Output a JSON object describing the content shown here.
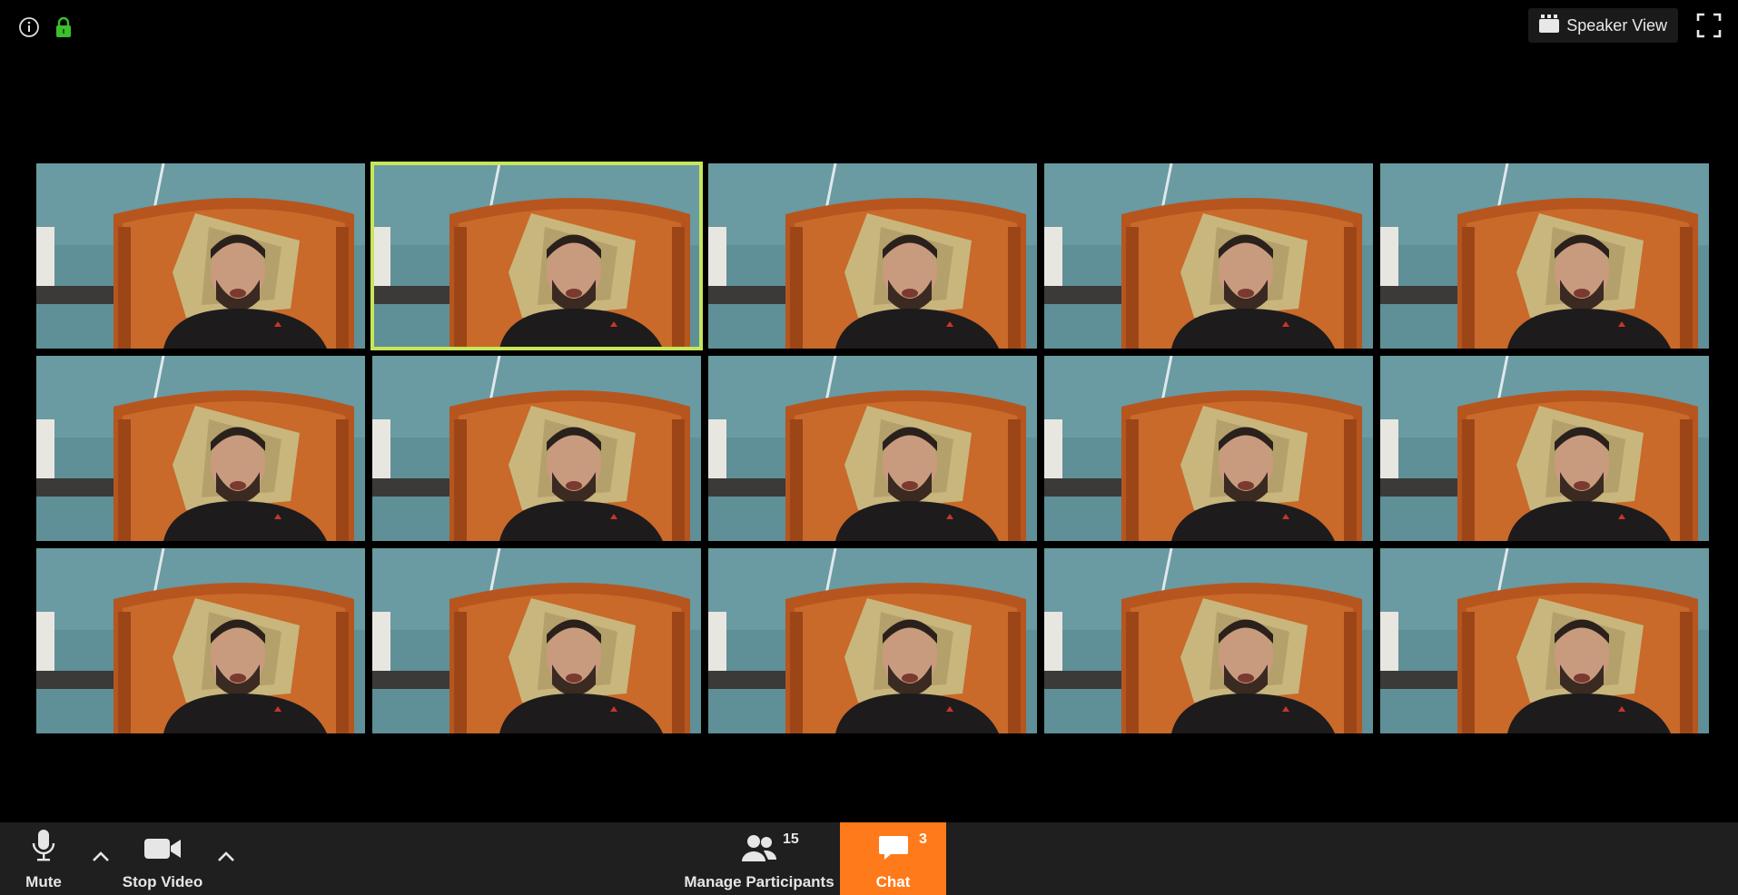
{
  "top": {
    "speaker_view_label": "Speaker View"
  },
  "toolbar": {
    "mute_label": "Mute",
    "stop_video_label": "Stop Video",
    "manage_participants_label": "Manage Participants",
    "participants_count": "15",
    "chat_label": "Chat",
    "chat_badge": "3"
  },
  "tiles": [
    {
      "active": false
    },
    {
      "active": true
    },
    {
      "active": false
    },
    {
      "active": false
    },
    {
      "active": false
    },
    {
      "active": false
    },
    {
      "active": false
    },
    {
      "active": false
    },
    {
      "active": false
    },
    {
      "active": false
    },
    {
      "active": false
    },
    {
      "active": false
    },
    {
      "active": false
    },
    {
      "active": false
    },
    {
      "active": false
    }
  ],
  "colors": {
    "chat_accent": "#ff7a1a",
    "active_speaker_border": "#c7e65a",
    "encryption_lock": "#3bbf2b"
  },
  "icons": [
    "info-icon",
    "lock-icon",
    "speaker-view-icon",
    "fullscreen-icon",
    "microphone-icon",
    "caret-up-icon",
    "video-camera-icon",
    "participants-icon",
    "chat-bubble-icon"
  ]
}
